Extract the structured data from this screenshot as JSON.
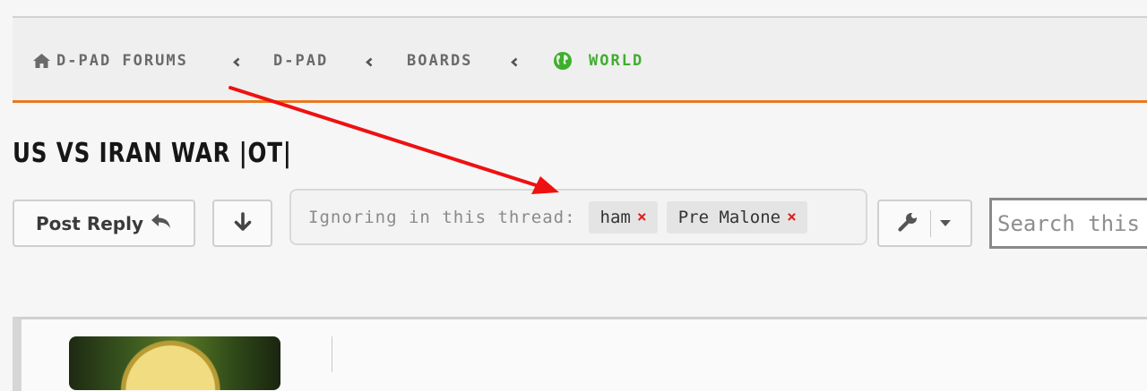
{
  "breadcrumb": {
    "items": [
      {
        "label": "D-PAD FORUMS",
        "icon": "home-icon"
      },
      {
        "label": "D-PAD"
      },
      {
        "label": "BOARDS"
      },
      {
        "label": "WORLD",
        "icon": "globe-icon",
        "color": "#3fae2e"
      }
    ],
    "separator_icon": "chevron-left-icon",
    "accent_color": "#e8791f"
  },
  "thread": {
    "title": "US VS IRAN WAR |OT|"
  },
  "toolbar": {
    "post_reply_label": "Post Reply",
    "post_reply_icon": "reply-icon",
    "jump_icon": "arrow-down-icon",
    "tools_icon": "wrench-icon",
    "tools_menu_icon": "caret-down-icon"
  },
  "ignore_filter": {
    "label": "Ignoring in this thread:",
    "users": [
      {
        "name": "ham",
        "remove_glyph": "×"
      },
      {
        "name": "Pre Malone",
        "remove_glyph": "×"
      }
    ],
    "remove_color": "#e02020"
  },
  "search": {
    "placeholder": "Search this thread",
    "value": ""
  },
  "annotation": {
    "type": "red-arrow",
    "color": "#ee1111"
  }
}
